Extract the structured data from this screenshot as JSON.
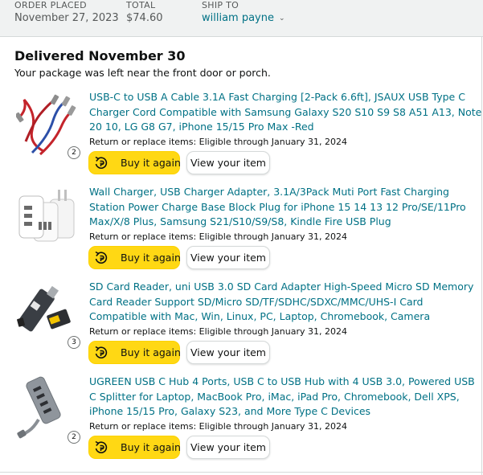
{
  "order": {
    "placed_label": "ORDER PLACED",
    "placed_value": "November 27, 2023",
    "total_label": "TOTAL",
    "total_value": "$74.60",
    "ship_label": "SHIP TO",
    "ship_value": "william payne"
  },
  "delivery": {
    "title": "Delivered November 30",
    "subtitle": "Your package was left near the front door or porch."
  },
  "items": [
    {
      "title": "USB-C to USB A Cable 3.1A Fast Charging [2-Pack 6.6ft], JSAUX USB Type C Charger Cord Compatible with Samsung Galaxy S20 S10 S9 S8 A51 A13, Note 20 10, LG G8 G7, iPhone 15/15 Pro Max -Red",
      "return_text": "Return or replace items: Eligible through January 31, 2024",
      "quantity": "2",
      "buy_label": "Buy it again",
      "view_label": "View your item"
    },
    {
      "title": "Wall Charger, USB Charger Adapter, 3.1A/3Pack Muti Port Fast Charging Station Power Charge Base Block Plug for iPhone 15 14 13 12 Pro/SE/11Pro Max/X/8 Plus, Samsung S21/S10/S9/S8, Kindle Fire USB Plug",
      "return_text": "Return or replace items: Eligible through January 31, 2024",
      "quantity": "",
      "buy_label": "Buy it again",
      "view_label": "View your item"
    },
    {
      "title": "SD Card Reader, uni USB 3.0 SD Card Adapter High-Speed Micro SD Memory Card Reader Support SD/Micro SD/TF/SDHC/SDXC/MMC/UHS-I Card Compatible with Mac, Win, Linux, PC, Laptop, Chromebook, Camera",
      "return_text": "Return or replace items: Eligible through January 31, 2024",
      "quantity": "3",
      "buy_label": "Buy it again",
      "view_label": "View your item"
    },
    {
      "title": "UGREEN USB C Hub 4 Ports, USB C to USB Hub with 4 USB 3.0, Powered USB C Splitter for Laptop, MacBook Pro, iMac, iPad Pro, Chromebook, Dell XPS, iPhone 15/15 Pro, Galaxy S23, and More Type C Devices",
      "return_text": "Return or replace items: Eligible through January 31, 2024",
      "quantity": "2",
      "buy_label": "Buy it again",
      "view_label": "View your item"
    }
  ],
  "icons": {
    "buy_again": "reorder-cycle-icon",
    "ship_caret": "chevron-down-icon"
  },
  "colors": {
    "link": "#007185",
    "buy_button": "#ffd814",
    "header_bg": "#f0f2f2"
  }
}
